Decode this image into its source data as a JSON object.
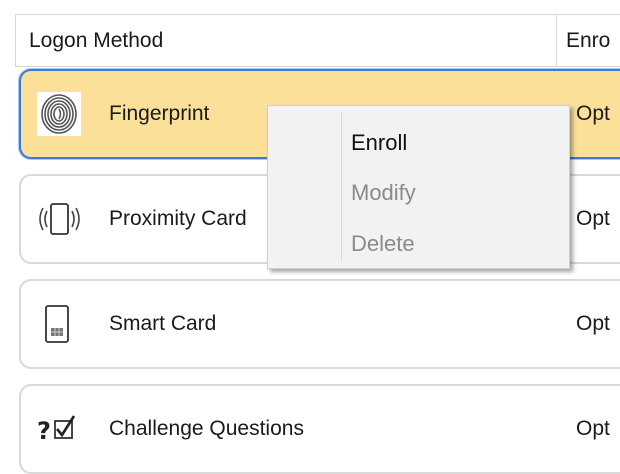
{
  "header": {
    "col_method": "Logon Method",
    "col_enroll": "Enro"
  },
  "rows": [
    {
      "label": "Fingerprint",
      "status": "Opt",
      "icon": "fingerprint-icon",
      "selected": true
    },
    {
      "label": "Proximity Card",
      "status": "Opt",
      "icon": "proximity-card-icon",
      "selected": false
    },
    {
      "label": "Smart Card",
      "status": "Opt",
      "icon": "smart-card-icon",
      "selected": false
    },
    {
      "label": "Challenge Questions",
      "status": "Opt",
      "icon": "challenge-questions-icon",
      "selected": false
    }
  ],
  "context_menu": {
    "items": [
      {
        "label": "Enroll",
        "enabled": true
      },
      {
        "label": "Modify",
        "enabled": false
      },
      {
        "label": "Delete",
        "enabled": false
      }
    ]
  },
  "colors": {
    "selection_fill": "#fbe09a",
    "selection_border": "#3c7bd7"
  }
}
